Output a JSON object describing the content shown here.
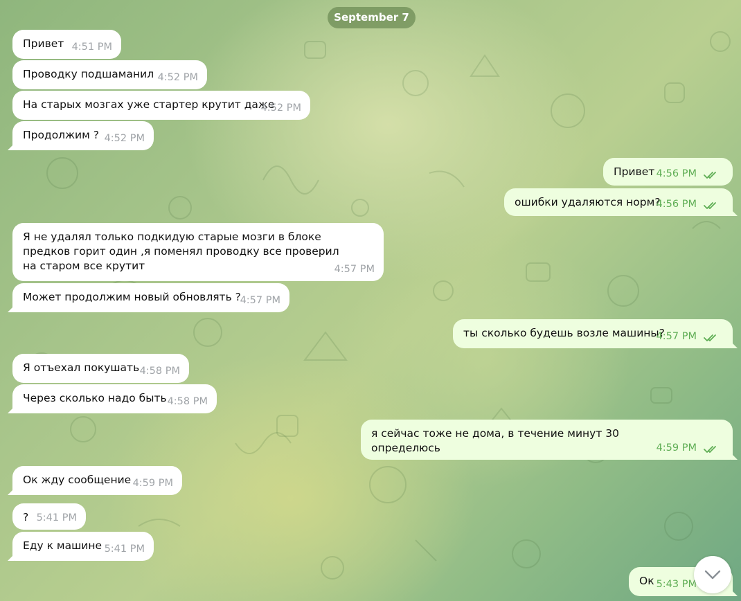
{
  "chat": {
    "date_label": "September 7",
    "messages": [
      {
        "dir": "in",
        "text": "Привет",
        "time": "4:51 PM"
      },
      {
        "dir": "in",
        "text": "Проводку подшаманил",
        "time": "4:52 PM"
      },
      {
        "dir": "in",
        "text": "На старых мозгах уже стартер крутит даже",
        "time": "4:52 PM"
      },
      {
        "dir": "in",
        "text": "Продолжим ?",
        "time": "4:52 PM"
      },
      {
        "dir": "out",
        "text": "Привет",
        "time": "4:56 PM",
        "read": true
      },
      {
        "dir": "out",
        "text": "ошибки удаляются норм?",
        "time": "4:56 PM",
        "read": true
      },
      {
        "dir": "in",
        "text": "Я не удалял только подкидую старые мозги в блоке предков горит один ,я поменял проводку все проверил на старом все крутит",
        "time": "4:57 PM"
      },
      {
        "dir": "in",
        "text": "Может продолжим новый обновлять ?",
        "time": "4:57 PM"
      },
      {
        "dir": "out",
        "text": "ты сколько будешь возле машины?",
        "time": "4:57 PM",
        "read": true
      },
      {
        "dir": "in",
        "text": "Я отъехал покушать",
        "time": "4:58 PM"
      },
      {
        "dir": "in",
        "text": "Через сколько надо быть",
        "time": "4:58 PM"
      },
      {
        "dir": "out",
        "text": "я сейчас тоже не дома, в течение минут 30 определюсь",
        "time": "4:59 PM",
        "read": true
      },
      {
        "dir": "in",
        "text": "Ок жду сообщение",
        "time": "4:59 PM"
      },
      {
        "dir": "in",
        "text": "?",
        "time": "5:41 PM"
      },
      {
        "dir": "in",
        "text": "Еду к машине",
        "time": "5:41 PM"
      },
      {
        "dir": "out",
        "text": "Ок",
        "time": "5:43 PM",
        "read": true
      }
    ]
  },
  "icons": {
    "read_receipt": "double-check-icon",
    "scroll_down": "chevron-down-icon"
  },
  "colors": {
    "incoming_bubble": "#ffffff",
    "outgoing_bubble": "#eefedf",
    "outgoing_time": "#5fae55",
    "incoming_time": "#a0a4a8",
    "date_pill": "#6e8c55"
  }
}
